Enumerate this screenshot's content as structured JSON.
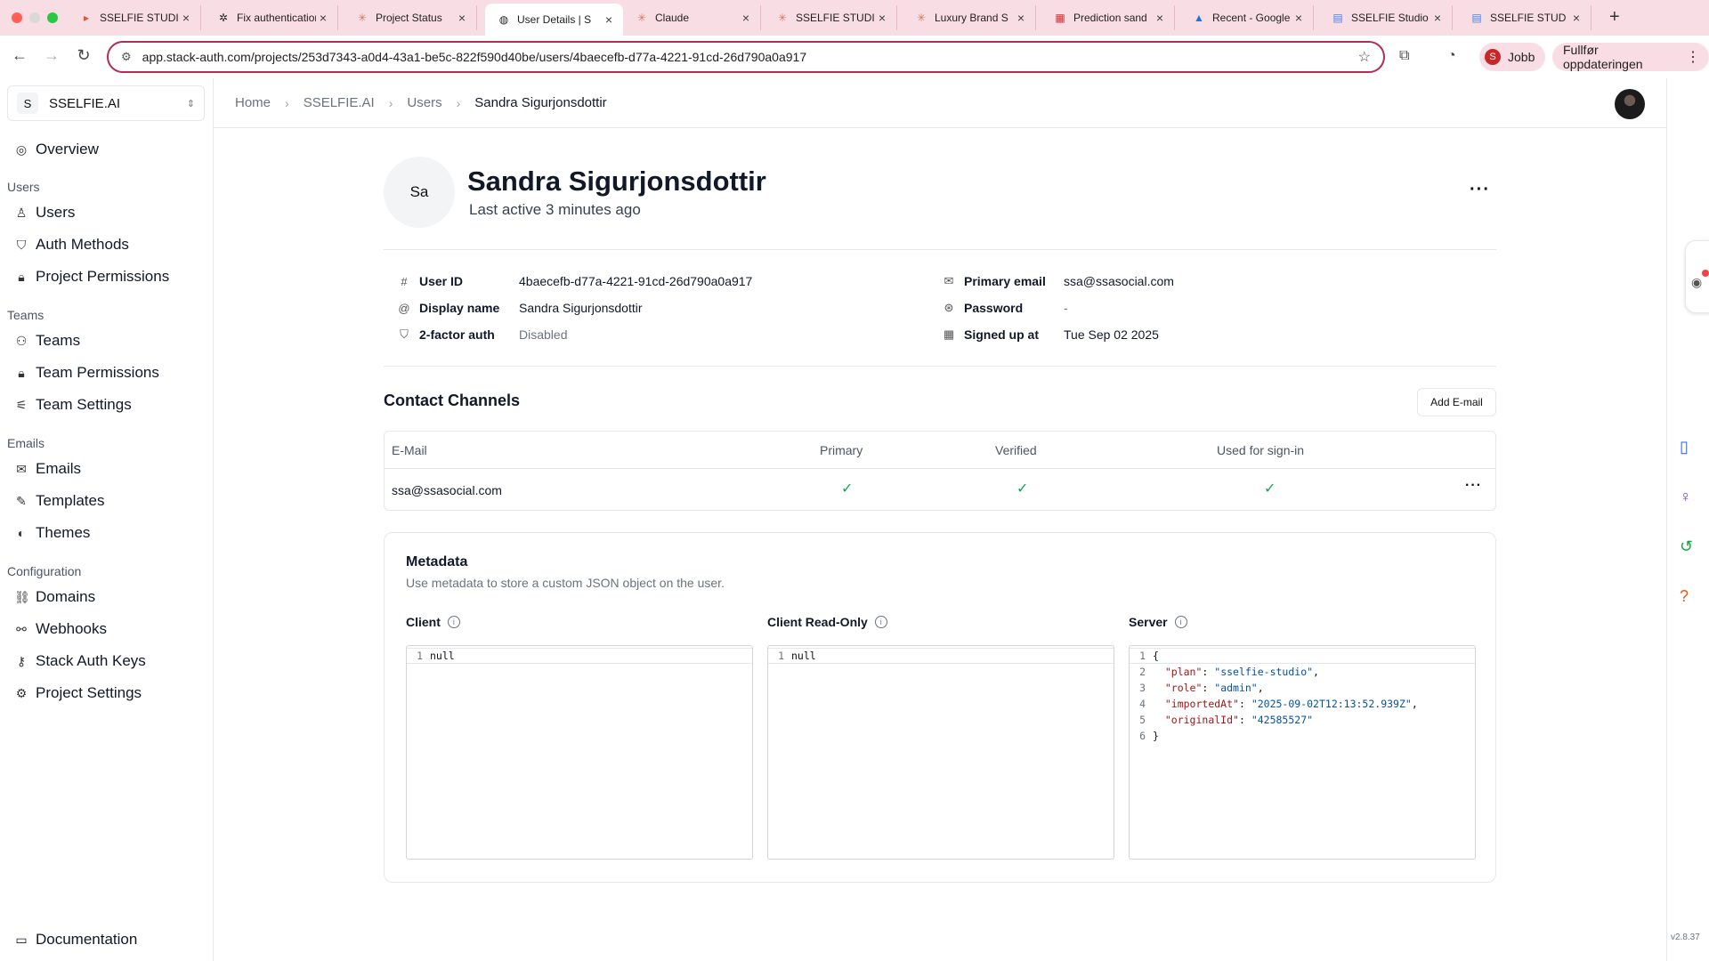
{
  "browser": {
    "tabs": [
      {
        "title": "SSELFIE STUDIO",
        "icon": "app-icon",
        "active": false
      },
      {
        "title": "Fix authentication",
        "icon": "openai-icon",
        "active": false
      },
      {
        "title": "Project Status",
        "icon": "claude-icon",
        "active": false
      },
      {
        "title": "User Details | S",
        "icon": "stack-auth-icon",
        "active": true
      },
      {
        "title": "Claude",
        "icon": "claude-icon",
        "active": false
      },
      {
        "title": "SSELFIE STUDIO",
        "icon": "claude-icon",
        "active": false
      },
      {
        "title": "Luxury Brand S",
        "icon": "claude-icon",
        "active": false
      },
      {
        "title": "Prediction sand",
        "icon": "replicate-icon",
        "active": false
      },
      {
        "title": "Recent - Google",
        "icon": "google-drive-icon",
        "active": false
      },
      {
        "title": "SSELFIE Studio",
        "icon": "google-docs-icon",
        "active": false
      },
      {
        "title": "SSELFIE STUD",
        "icon": "google-docs-icon",
        "active": false
      }
    ],
    "url": "app.stack-auth.com/projects/253d7343-a0d4-43a1-be5c-822f590d40be/users/4baecefb-d77a-4221-91cd-26d790a0a917",
    "profile_name": "Jobb",
    "profile_initial": "S",
    "update_label": "Fullfør oppdateringen"
  },
  "project": {
    "badge": "S",
    "name": "SSELFIE.AI"
  },
  "sidebar": {
    "overview": "Overview",
    "sections": {
      "users": "Users",
      "teams": "Teams",
      "emails": "Emails",
      "configuration": "Configuration"
    },
    "items": {
      "users": "Users",
      "auth_methods": "Auth Methods",
      "project_permissions": "Project Permissions",
      "teams": "Teams",
      "team_permissions": "Team Permissions",
      "team_settings": "Team Settings",
      "emails": "Emails",
      "templates": "Templates",
      "themes": "Themes",
      "domains": "Domains",
      "webhooks": "Webhooks",
      "stack_auth_keys": "Stack Auth Keys",
      "project_settings": "Project Settings"
    },
    "documentation": "Documentation"
  },
  "breadcrumb": [
    "Home",
    "SSELFIE.AI",
    "Users",
    "Sandra Sigurjonsdottir"
  ],
  "user": {
    "initials": "Sa",
    "name": "Sandra Sigurjonsdottir",
    "last_active": "Last active 3 minutes ago",
    "fields": {
      "user_id_label": "User ID",
      "user_id": "4baecefb-d77a-4221-91cd-26d790a0a917",
      "display_name_label": "Display name",
      "display_name": "Sandra Sigurjonsdottir",
      "two_factor_label": "2-factor auth",
      "two_factor": "Disabled",
      "primary_email_label": "Primary email",
      "primary_email": "ssa@ssasocial.com",
      "password_label": "Password",
      "password": "-",
      "signed_up_label": "Signed up at",
      "signed_up": "Tue Sep 02 2025"
    }
  },
  "contact_channels": {
    "title": "Contact Channels",
    "add_label": "Add E-mail",
    "columns": [
      "E-Mail",
      "Primary",
      "Verified",
      "Used for sign-in"
    ],
    "rows": [
      {
        "email": "ssa@ssasocial.com",
        "primary": true,
        "verified": true,
        "used_for_sign_in": true
      }
    ]
  },
  "metadata": {
    "title": "Metadata",
    "description": "Use metadata to store a custom JSON object on the user.",
    "client_label": "Client",
    "client_readonly_label": "Client Read-Only",
    "server_label": "Server",
    "client_value": "null",
    "client_readonly_value": "null",
    "server_lines": [
      "{",
      "\"plan\"",
      "\"sselfie-studio\"",
      "\"role\"",
      "\"admin\"",
      "\"importedAt\"",
      "\"2025-09-02T12:13:52.939Z\"",
      "\"originalId\"",
      "\"42585527\"",
      "}"
    ]
  },
  "version": "v2.8.37",
  "colors": {
    "accent": "#b22d52",
    "check": "#16a34a",
    "chrome_bg": "#f9dde4"
  }
}
